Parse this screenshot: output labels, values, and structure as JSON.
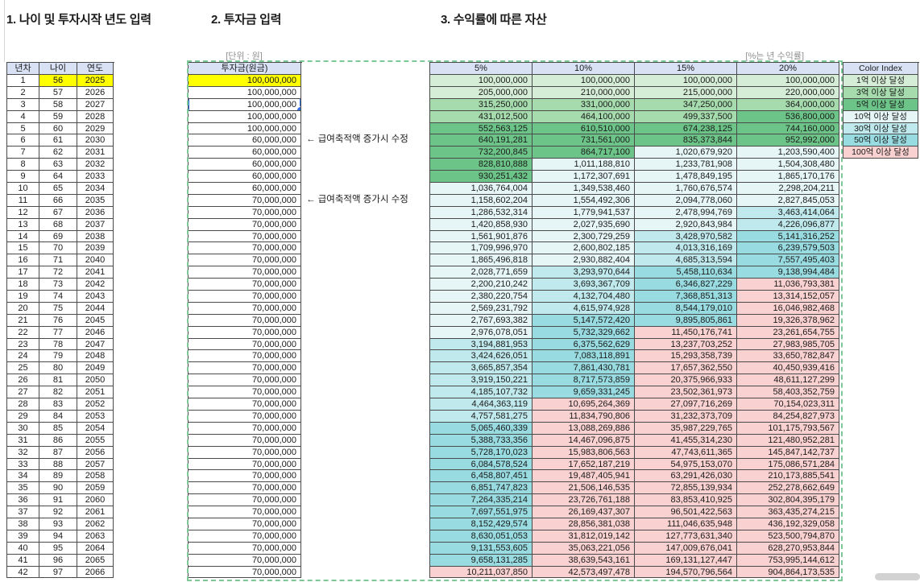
{
  "titles": {
    "section1": "1. 나이 및 투자시작 년도 입력",
    "section2": "2. 투자금 입력",
    "section3": "3. 수익률에 따른 자산"
  },
  "labels": {
    "unit_note": "[단위 : 원]",
    "rate_note": "[%는 년 수익률]"
  },
  "left_table": {
    "headers": [
      "년차",
      "나이",
      "연도"
    ],
    "rows": [
      [
        1,
        56,
        2025
      ],
      [
        2,
        57,
        2026
      ],
      [
        3,
        58,
        2027
      ],
      [
        4,
        59,
        2028
      ],
      [
        5,
        60,
        2029
      ],
      [
        6,
        61,
        2030
      ],
      [
        7,
        62,
        2031
      ],
      [
        8,
        63,
        2032
      ],
      [
        9,
        64,
        2033
      ],
      [
        10,
        65,
        2034
      ],
      [
        11,
        66,
        2035
      ],
      [
        12,
        67,
        2036
      ],
      [
        13,
        68,
        2037
      ],
      [
        14,
        69,
        2038
      ],
      [
        15,
        70,
        2039
      ],
      [
        16,
        71,
        2040
      ],
      [
        17,
        72,
        2041
      ],
      [
        18,
        73,
        2042
      ],
      [
        19,
        74,
        2043
      ],
      [
        20,
        75,
        2044
      ],
      [
        21,
        76,
        2045
      ],
      [
        22,
        77,
        2046
      ],
      [
        23,
        78,
        2047
      ],
      [
        24,
        79,
        2048
      ],
      [
        25,
        80,
        2049
      ],
      [
        26,
        81,
        2050
      ],
      [
        27,
        82,
        2051
      ],
      [
        28,
        83,
        2052
      ],
      [
        29,
        84,
        2053
      ],
      [
        30,
        85,
        2054
      ],
      [
        31,
        86,
        2055
      ],
      [
        32,
        87,
        2056
      ],
      [
        33,
        88,
        2057
      ],
      [
        34,
        89,
        2058
      ],
      [
        35,
        90,
        2059
      ],
      [
        36,
        91,
        2060
      ],
      [
        37,
        92,
        2061
      ],
      [
        38,
        93,
        2062
      ],
      [
        39,
        94,
        2063
      ],
      [
        40,
        95,
        2064
      ],
      [
        41,
        96,
        2065
      ],
      [
        42,
        97,
        2066
      ]
    ]
  },
  "investment": {
    "header": "투자금(원금)",
    "selected_row_number": 3,
    "highlight_row_number": 1,
    "values": [
      "100,000,000",
      "100,000,000",
      "100,000,000",
      "100,000,000",
      "100,000,000",
      "60,000,000",
      "60,000,000",
      "60,000,000",
      "60,000,000",
      "60,000,000",
      "70,000,000",
      "70,000,000",
      "70,000,000",
      "70,000,000",
      "70,000,000",
      "70,000,000",
      "70,000,000",
      "70,000,000",
      "70,000,000",
      "70,000,000",
      "70,000,000",
      "70,000,000",
      "70,000,000",
      "70,000,000",
      "70,000,000",
      "70,000,000",
      "70,000,000",
      "70,000,000",
      "70,000,000",
      "70,000,000",
      "70,000,000",
      "70,000,000",
      "70,000,000",
      "70,000,000",
      "70,000,000",
      "70,000,000",
      "70,000,000",
      "70,000,000",
      "70,000,000",
      "70,000,000",
      "70,000,000",
      "70,000,000"
    ],
    "annotations": [
      {
        "row": 6,
        "text": "← 급여축적액 증가시 수정"
      },
      {
        "row": 11,
        "text": "← 급여축적액 증가시 수정"
      }
    ]
  },
  "main_table": {
    "headers": [
      "5%",
      "10%",
      "15%",
      "20%"
    ],
    "rows": [
      [
        "100,000,000",
        "100,000,000",
        "100,000,000",
        "100,000,000"
      ],
      [
        "205,000,000",
        "210,000,000",
        "215,000,000",
        "220,000,000"
      ],
      [
        "315,250,000",
        "331,000,000",
        "347,250,000",
        "364,000,000"
      ],
      [
        "431,012,500",
        "464,100,000",
        "499,337,500",
        "536,800,000"
      ],
      [
        "552,563,125",
        "610,510,000",
        "674,238,125",
        "744,160,000"
      ],
      [
        "640,191,281",
        "731,561,000",
        "835,373,844",
        "952,992,000"
      ],
      [
        "732,200,845",
        "864,717,100",
        "1,020,679,920",
        "1,203,590,400"
      ],
      [
        "828,810,888",
        "1,011,188,810",
        "1,233,781,908",
        "1,504,308,480"
      ],
      [
        "930,251,432",
        "1,172,307,691",
        "1,478,849,195",
        "1,865,170,176"
      ],
      [
        "1,036,764,004",
        "1,349,538,460",
        "1,760,676,574",
        "2,298,204,211"
      ],
      [
        "1,158,602,204",
        "1,554,492,306",
        "2,094,778,060",
        "2,827,845,053"
      ],
      [
        "1,286,532,314",
        "1,779,941,537",
        "2,478,994,769",
        "3,463,414,064"
      ],
      [
        "1,420,858,930",
        "2,027,935,690",
        "2,920,843,984",
        "4,226,096,877"
      ],
      [
        "1,561,901,876",
        "2,300,729,259",
        "3,428,970,582",
        "5,141,316,252"
      ],
      [
        "1,709,996,970",
        "2,600,802,185",
        "4,013,316,169",
        "6,239,579,503"
      ],
      [
        "1,865,496,818",
        "2,930,882,404",
        "4,685,313,594",
        "7,557,495,403"
      ],
      [
        "2,028,771,659",
        "3,293,970,644",
        "5,458,110,634",
        "9,138,994,484"
      ],
      [
        "2,200,210,242",
        "3,693,367,709",
        "6,346,827,229",
        "11,036,793,381"
      ],
      [
        "2,380,220,754",
        "4,132,704,480",
        "7,368,851,313",
        "13,314,152,057"
      ],
      [
        "2,569,231,792",
        "4,615,974,928",
        "8,544,179,010",
        "16,046,982,468"
      ],
      [
        "2,767,693,382",
        "5,147,572,420",
        "9,895,805,861",
        "19,326,378,962"
      ],
      [
        "2,976,078,051",
        "5,732,329,662",
        "11,450,176,741",
        "23,261,654,755"
      ],
      [
        "3,194,881,953",
        "6,375,562,629",
        "13,237,703,252",
        "27,983,985,705"
      ],
      [
        "3,424,626,051",
        "7,083,118,891",
        "15,293,358,739",
        "33,650,782,847"
      ],
      [
        "3,665,857,354",
        "7,861,430,781",
        "17,657,362,550",
        "40,450,939,416"
      ],
      [
        "3,919,150,221",
        "8,717,573,859",
        "20,375,966,933",
        "48,611,127,299"
      ],
      [
        "4,185,107,732",
        "9,659,331,245",
        "23,502,361,973",
        "58,403,352,759"
      ],
      [
        "4,464,363,119",
        "10,695,264,369",
        "27,097,716,269",
        "70,154,023,311"
      ],
      [
        "4,757,581,275",
        "11,834,790,806",
        "31,232,373,709",
        "84,254,827,973"
      ],
      [
        "5,065,460,339",
        "13,088,269,886",
        "35,987,229,765",
        "101,175,793,567"
      ],
      [
        "5,388,733,356",
        "14,467,096,875",
        "41,455,314,230",
        "121,480,952,281"
      ],
      [
        "5,728,170,023",
        "15,983,806,563",
        "47,743,611,365",
        "145,847,142,737"
      ],
      [
        "6,084,578,524",
        "17,652,187,219",
        "54,975,153,070",
        "175,086,571,284"
      ],
      [
        "6,458,807,451",
        "19,487,405,941",
        "63,291,426,030",
        "210,173,885,541"
      ],
      [
        "6,851,747,823",
        "21,506,146,535",
        "72,855,139,934",
        "252,278,662,649"
      ],
      [
        "7,264,335,214",
        "23,726,761,188",
        "83,853,410,925",
        "302,804,395,179"
      ],
      [
        "7,697,551,975",
        "26,169,437,307",
        "96,501,422,563",
        "363,435,274,215"
      ],
      [
        "8,152,429,574",
        "28,856,381,038",
        "111,046,635,948",
        "436,192,329,058"
      ],
      [
        "8,630,051,053",
        "31,812,019,142",
        "127,773,631,340",
        "523,500,794,870"
      ],
      [
        "9,131,553,605",
        "35,063,221,056",
        "147,009,676,041",
        "628,270,953,844"
      ],
      [
        "9,658,131,285",
        "38,639,543,161",
        "169,131,127,447",
        "753,995,144,612"
      ],
      [
        "10,211,037,850",
        "42,573,497,478",
        "194,570,796,564",
        "904,864,173,535"
      ]
    ]
  },
  "color_index": {
    "header": "Color Index",
    "items": [
      {
        "label": "1억 이상 달성",
        "color": "#D5EDD6"
      },
      {
        "label": "3억 이상 달성",
        "color": "#A5DBAD"
      },
      {
        "label": "5억 이상 달성",
        "color": "#6CC488"
      },
      {
        "label": "10억 이상 달성",
        "color": "#E6F6F6"
      },
      {
        "label": "30억 이상 달성",
        "color": "#BFE9EC"
      },
      {
        "label": "50억 이상 달성",
        "color": "#98DBE0"
      },
      {
        "label": "100억 이상 달성",
        "color": "#F9D1D0"
      }
    ]
  },
  "colors": {
    "header_fill": "#D9E2F4",
    "highlight_yellow": "#FFFF00",
    "selection_blue": "#2F6FE4",
    "marquee_green": "#7CC997",
    "tiers": [
      {
        "min": 10000000000,
        "color": "#F9D1D0"
      },
      {
        "min": 5000000000,
        "color": "#98DBE0"
      },
      {
        "min": 3000000000,
        "color": "#BFE9EC"
      },
      {
        "min": 1000000000,
        "color": "#E6F6F6"
      },
      {
        "min": 500000000,
        "color": "#6CC488"
      },
      {
        "min": 300000000,
        "color": "#A5DBAD"
      },
      {
        "min": 100000000,
        "color": "#D5EDD6"
      }
    ]
  }
}
